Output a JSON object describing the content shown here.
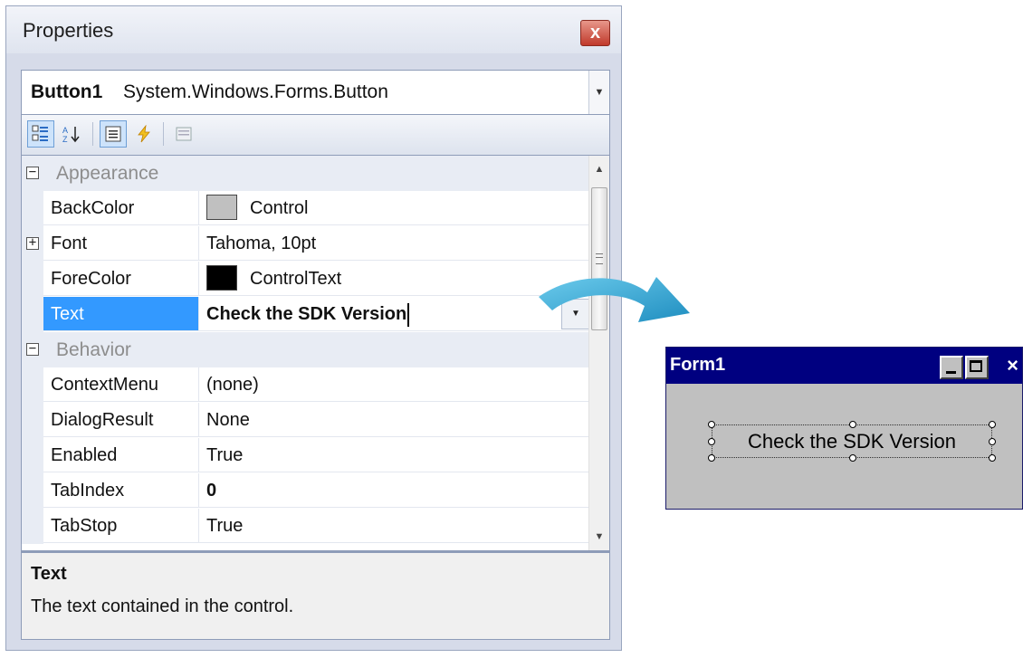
{
  "properties_panel": {
    "title": "Properties",
    "close_glyph": "x",
    "object_selector": {
      "name": "Button1",
      "type": "System.Windows.Forms.Button"
    },
    "toolbar": {
      "categorized_icon": "categorized-icon",
      "alphabetical_icon": "alphabetical-icon",
      "properties_icon": "properties-icon",
      "events_icon": "events-icon",
      "property_pages_icon": "property-pages-icon"
    },
    "rows": [
      {
        "kind": "category",
        "label": "Appearance",
        "toggle": "⊟"
      },
      {
        "kind": "prop",
        "name": "BackColor",
        "value": "Control",
        "swatch": "#c0c0c0"
      },
      {
        "kind": "prop",
        "name": "Font",
        "value": "Tahoma, 10pt",
        "toggle": "⊞"
      },
      {
        "kind": "prop",
        "name": "ForeColor",
        "value": "ControlText",
        "swatch": "#000000"
      },
      {
        "kind": "prop",
        "name": "Text",
        "value": "Check the SDK Version",
        "selected": true
      },
      {
        "kind": "category",
        "label": "Behavior",
        "toggle": "⊟"
      },
      {
        "kind": "prop",
        "name": "ContextMenu",
        "value": "(none)"
      },
      {
        "kind": "prop",
        "name": "DialogResult",
        "value": "None"
      },
      {
        "kind": "prop",
        "name": "Enabled",
        "value": "True"
      },
      {
        "kind": "prop",
        "name": "TabIndex",
        "value": "0"
      },
      {
        "kind": "prop",
        "name": "TabStop",
        "value": "True"
      }
    ],
    "description": {
      "title": "Text",
      "text": "The text contained in the control."
    }
  },
  "arrow_color": "#3aaad6",
  "form": {
    "title": "Form1",
    "close_glyph": "×",
    "button_label": "Check the SDK Version",
    "title_bar_color": "#000080"
  }
}
